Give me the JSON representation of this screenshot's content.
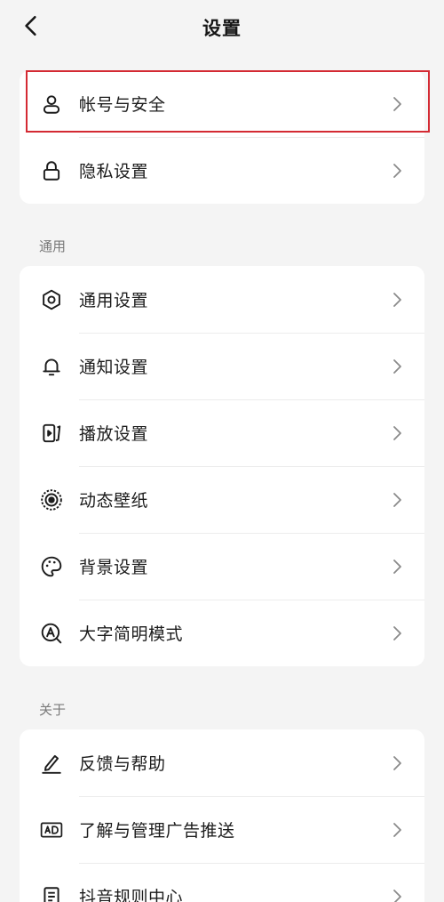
{
  "header": {
    "title": "设置"
  },
  "account_card": {
    "items": [
      {
        "label": "帐号与安全",
        "icon": "user-icon"
      },
      {
        "label": "隐私设置",
        "icon": "lock-icon"
      }
    ]
  },
  "general_section": {
    "title": "通用",
    "items": [
      {
        "label": "通用设置",
        "icon": "gear-icon"
      },
      {
        "label": "通知设置",
        "icon": "bell-icon"
      },
      {
        "label": "播放设置",
        "icon": "play-settings-icon"
      },
      {
        "label": "动态壁纸",
        "icon": "dynamic-wallpaper-icon"
      },
      {
        "label": "背景设置",
        "icon": "palette-icon"
      },
      {
        "label": "大字简明模式",
        "icon": "large-font-mode-icon"
      }
    ]
  },
  "about_section": {
    "title": "关于",
    "items": [
      {
        "label": "反馈与帮助",
        "icon": "pencil-icon"
      },
      {
        "label": "了解与管理广告推送",
        "icon": "ad-icon"
      },
      {
        "label": "抖音规则中心",
        "icon": "document-icon"
      }
    ]
  },
  "colors": {
    "background": "#f4f4f4",
    "card": "#ffffff",
    "highlight": "#d42a33"
  }
}
